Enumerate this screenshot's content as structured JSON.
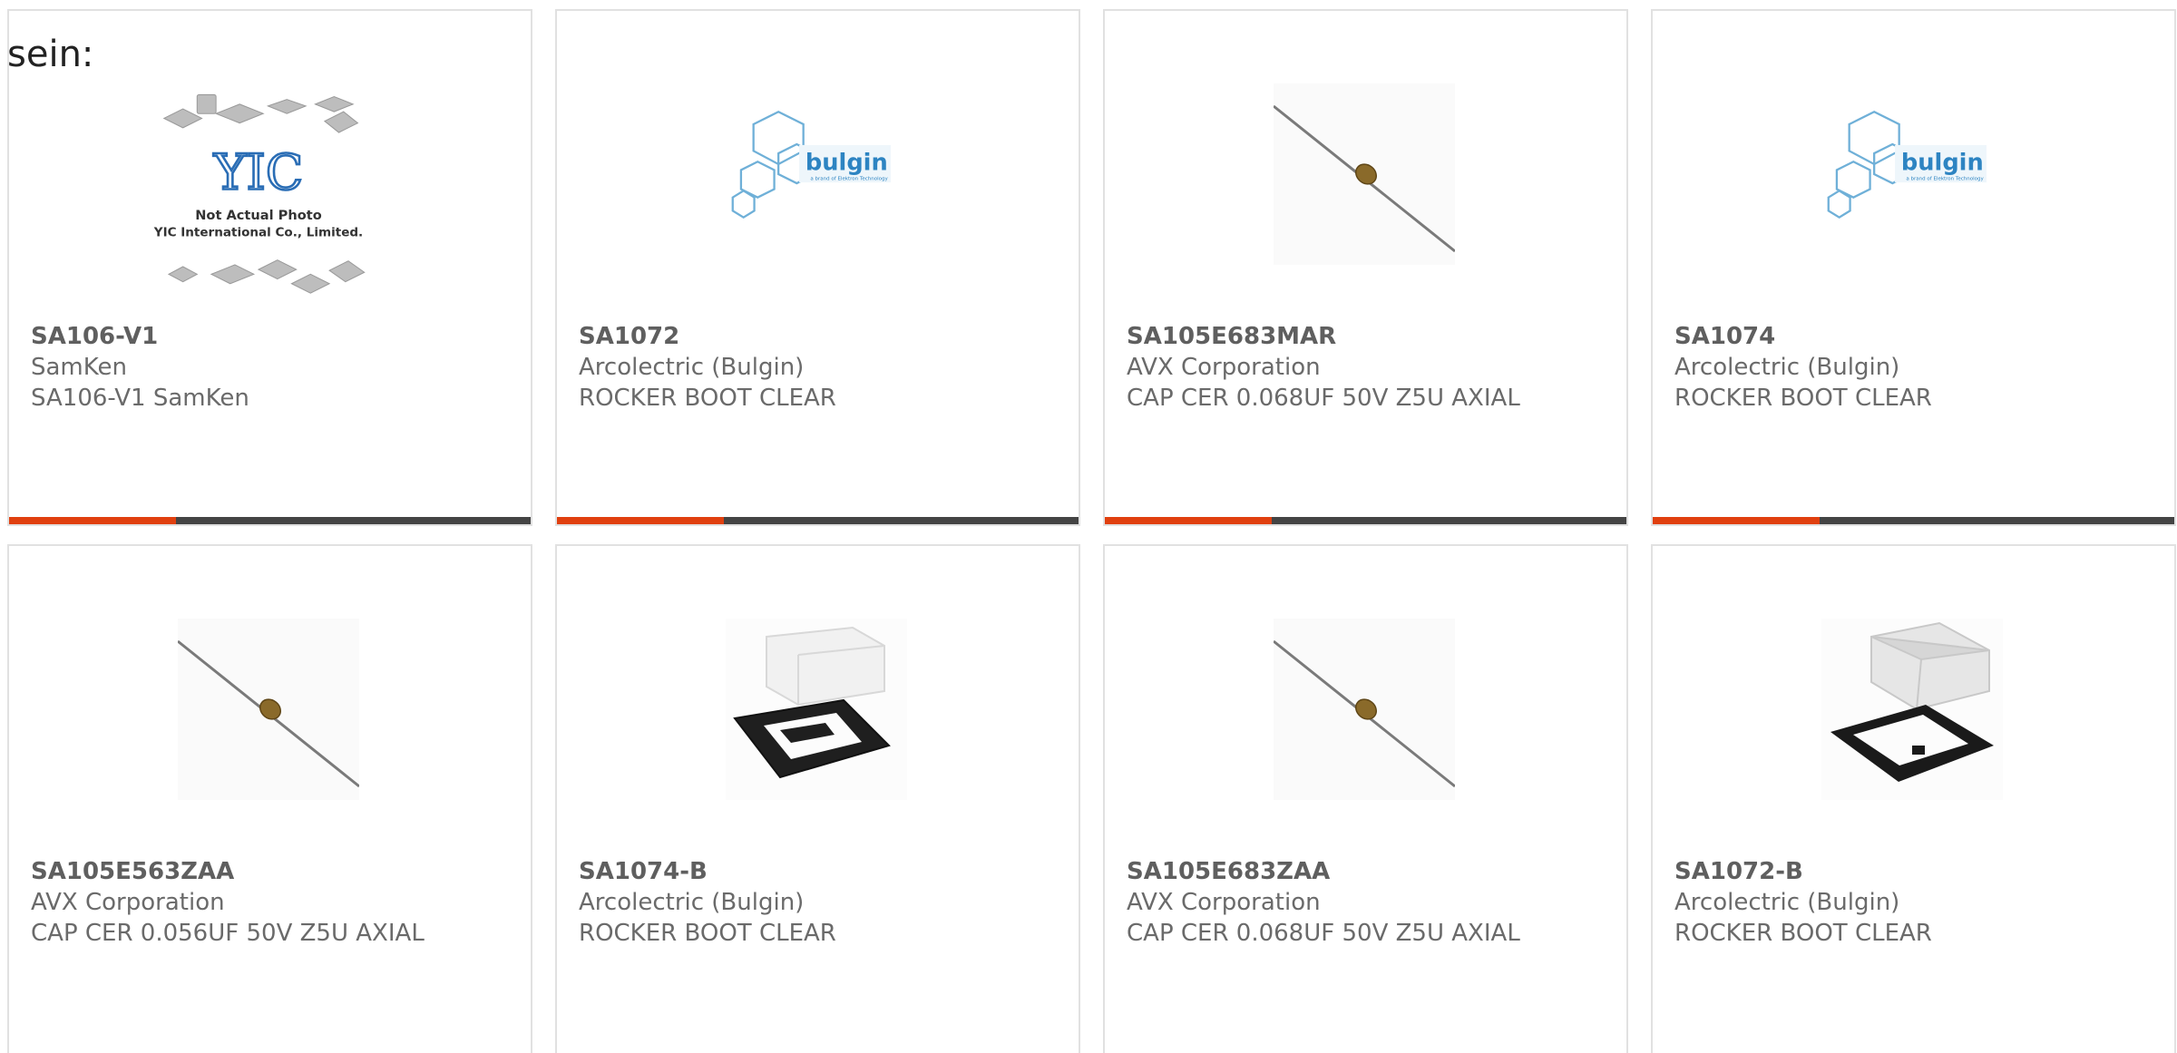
{
  "intro_text": "sein:",
  "colors": {
    "accent": "#e0400f",
    "bar_dark": "#444444",
    "border": "#e1e1e1",
    "text": "#6a6a6a"
  },
  "cards": [
    {
      "part": "SA106-V1",
      "manufacturer": "SamKen",
      "description": "SA106-V1 SamKen",
      "image": "yic-placeholder",
      "progress": 0.32,
      "photo_text": [
        "Not Actual Photo",
        "YIC International Co., Limited."
      ]
    },
    {
      "part": "SA1072",
      "manufacturer": "Arcolectric (Bulgin)",
      "description": "ROCKER BOOT CLEAR",
      "image": "bulgin-logo",
      "progress": 0.32,
      "photo_text": [
        "bulgin",
        "a brand of Elektron Technology"
      ]
    },
    {
      "part": "SA105E683MAR",
      "manufacturer": "AVX Corporation",
      "description": "CAP CER 0.068UF 50V Z5U AXIAL",
      "image": "axial-capacitor",
      "progress": 0.32
    },
    {
      "part": "SA1074",
      "manufacturer": "Arcolectric (Bulgin)",
      "description": "ROCKER BOOT CLEAR",
      "image": "bulgin-logo",
      "progress": 0.32,
      "photo_text": [
        "bulgin",
        "a brand of Elektron Technology"
      ]
    },
    {
      "part": "SA105E563ZAA",
      "manufacturer": "AVX Corporation",
      "description": "CAP CER 0.056UF 50V Z5U AXIAL",
      "image": "axial-capacitor"
    },
    {
      "part": "SA1074-B",
      "manufacturer": "Arcolectric (Bulgin)",
      "description": "ROCKER BOOT CLEAR",
      "image": "rocker-boot-rect"
    },
    {
      "part": "SA105E683ZAA",
      "manufacturer": "AVX Corporation",
      "description": "CAP CER 0.068UF 50V Z5U AXIAL",
      "image": "axial-capacitor"
    },
    {
      "part": "SA1072-B",
      "manufacturer": "Arcolectric (Bulgin)",
      "description": "ROCKER BOOT CLEAR",
      "image": "rocker-boot-square"
    }
  ]
}
